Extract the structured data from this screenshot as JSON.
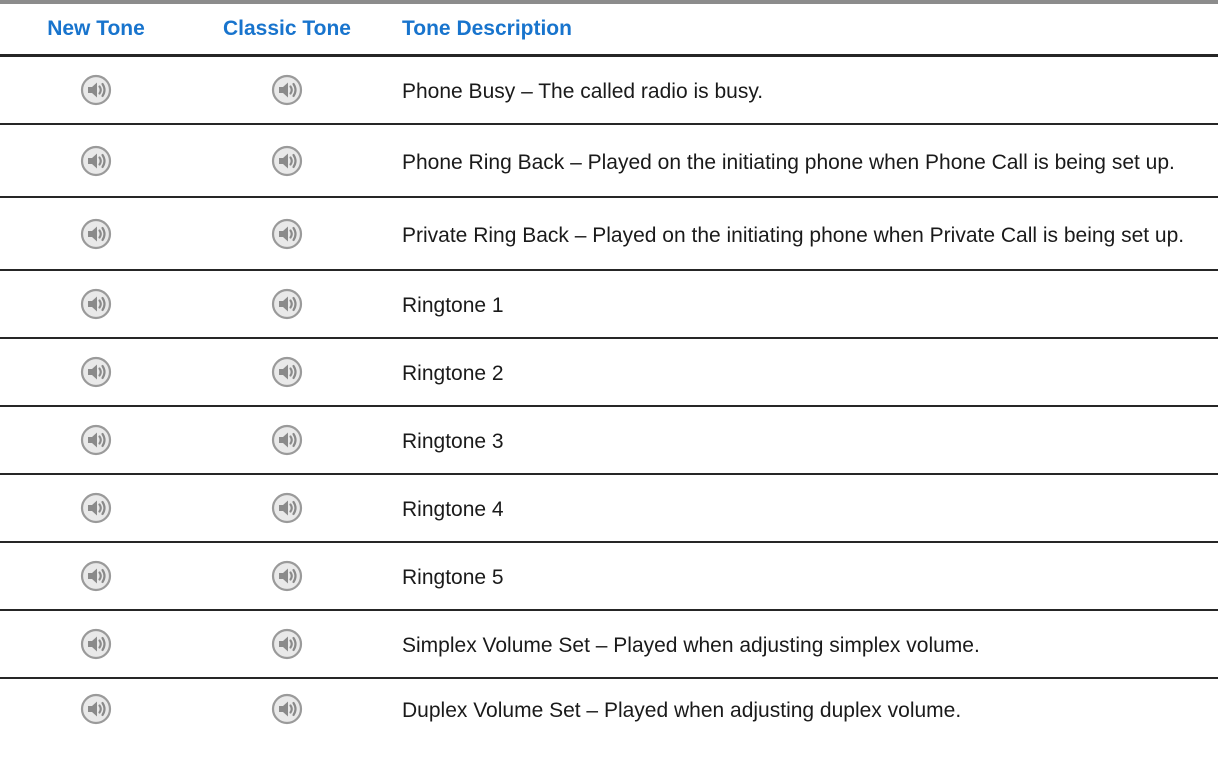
{
  "table": {
    "headers": {
      "new_tone": "New Tone",
      "classic_tone": "Classic Tone",
      "description": "Tone Description"
    },
    "rows": [
      {
        "description": "Phone Busy – The called radio is busy.",
        "lines": 1
      },
      {
        "description": "Phone Ring Back – Played on the initiating phone when Phone Call is being set up.",
        "lines": 2
      },
      {
        "description": "Private Ring Back – Played on the initiating phone when Private Call is being set up.",
        "lines": 2
      },
      {
        "description": "Ringtone 1",
        "lines": 1
      },
      {
        "description": "Ringtone 2",
        "lines": 1
      },
      {
        "description": "Ringtone 3",
        "lines": 1
      },
      {
        "description": "Ringtone 4",
        "lines": 1
      },
      {
        "description": "Ringtone 5",
        "lines": 1
      },
      {
        "description": "Simplex Volume Set – Played when adjusting simplex volume.",
        "lines": 1
      },
      {
        "description": "Duplex Volume Set – Played when adjusting duplex volume.",
        "lines": 1
      }
    ],
    "icon": "speaker-play-icon",
    "colors": {
      "header_text": "#1874cd",
      "top_rule": "#8c8c8c",
      "row_rule": "#262626",
      "icon_gray": "#9a9a9a"
    }
  }
}
